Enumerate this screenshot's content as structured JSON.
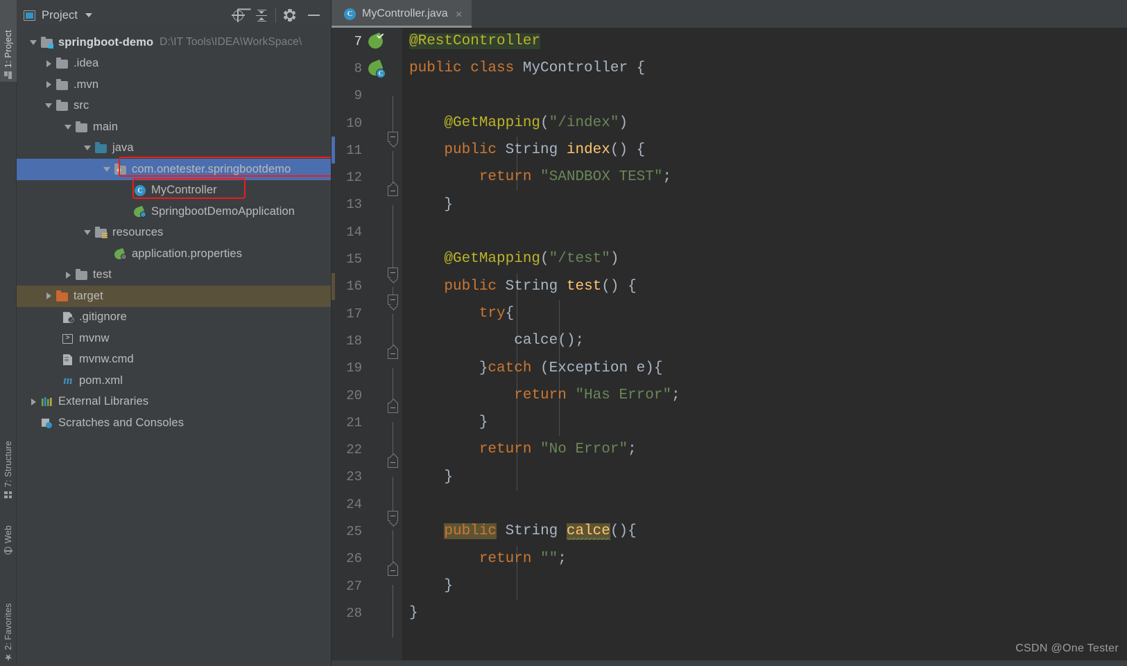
{
  "tool_strip": {
    "tabs": [
      {
        "label": "1: Project",
        "icon": "project-icon",
        "active": true
      },
      {
        "label": "7: Structure",
        "icon": "structure-icon",
        "active": false
      },
      {
        "label": "Web",
        "icon": "web-icon",
        "active": false
      },
      {
        "label": "2: Favorites",
        "icon": "favorites-icon",
        "active": false
      }
    ]
  },
  "project_panel": {
    "title": "Project",
    "toolbar": {
      "locate_icon": "crosshair-locate-icon",
      "collapse_icon": "collapse-all-icon",
      "settings_icon": "gear-icon",
      "minimize_icon": "minimize-icon"
    },
    "tree": [
      {
        "label": "springboot-demo",
        "path": "D:\\IT Tools\\IDEA\\WorkSpace\\",
        "depth": 0,
        "twist": "open",
        "icon": "module-folder-icon",
        "bold": true
      },
      {
        "label": ".idea",
        "path": "",
        "depth": 1,
        "twist": "closed",
        "icon": "folder-icon",
        "bold": false
      },
      {
        "label": ".mvn",
        "path": "",
        "depth": 1,
        "twist": "closed",
        "icon": "folder-icon",
        "bold": false
      },
      {
        "label": "src",
        "path": "",
        "depth": 1,
        "twist": "open",
        "icon": "folder-icon",
        "bold": false
      },
      {
        "label": "main",
        "path": "",
        "depth": 2,
        "twist": "open",
        "icon": "folder-icon",
        "bold": false
      },
      {
        "label": "java",
        "path": "",
        "depth": 3,
        "twist": "open",
        "icon": "source-root-folder-icon",
        "bold": false
      },
      {
        "label": "com.onetester.springbootdemo",
        "path": "",
        "depth": 4,
        "twist": "open",
        "icon": "package-icon",
        "bold": false,
        "selected": true,
        "annotated": true
      },
      {
        "label": "MyController",
        "path": "",
        "depth": 5,
        "twist": "none",
        "icon": "java-class-icon",
        "bold": false,
        "annotated": true
      },
      {
        "label": "SpringbootDemoApplication",
        "path": "",
        "depth": 5,
        "twist": "none",
        "icon": "spring-class-icon",
        "bold": false
      },
      {
        "label": "resources",
        "path": "",
        "depth": 3,
        "twist": "open",
        "icon": "resources-folder-icon",
        "bold": false
      },
      {
        "label": "application.properties",
        "path": "",
        "depth": 4,
        "twist": "none",
        "icon": "spring-properties-icon",
        "bold": false
      },
      {
        "label": "test",
        "path": "",
        "depth": 2,
        "twist": "closed",
        "icon": "folder-icon",
        "bold": false
      },
      {
        "label": "target",
        "path": "",
        "depth": 1,
        "twist": "closed",
        "icon": "excluded-folder-icon",
        "bold": false,
        "highlighted": true
      },
      {
        "label": ".gitignore",
        "path": "",
        "depth": 1,
        "twist": "none",
        "icon": "gitignore-file-icon",
        "bold": false
      },
      {
        "label": "mvnw",
        "path": "",
        "depth": 1,
        "twist": "none",
        "icon": "shell-script-icon",
        "bold": false
      },
      {
        "label": "mvnw.cmd",
        "path": "",
        "depth": 1,
        "twist": "none",
        "icon": "cmd-file-icon",
        "bold": false
      },
      {
        "label": "pom.xml",
        "path": "",
        "depth": 1,
        "twist": "none",
        "icon": "maven-pom-icon",
        "bold": false
      },
      {
        "label": "External Libraries",
        "path": "",
        "depth": 0,
        "twist": "closed",
        "icon": "external-libraries-icon",
        "bold": false
      },
      {
        "label": "Scratches and Consoles",
        "path": "",
        "depth": 0,
        "twist": "none",
        "icon": "scratches-icon",
        "bold": false
      }
    ]
  },
  "editor": {
    "tab": {
      "label": "MyController.java",
      "icon_letter": "C",
      "close_label": "×"
    },
    "first_line_number": 7,
    "lines": [
      {
        "num": 7,
        "gutter_icon": "spring-bean-check-icon",
        "fold": "none",
        "current": true,
        "tokens": [
          {
            "t": "@RestController",
            "c": "anno",
            "hl": "green"
          }
        ]
      },
      {
        "num": 8,
        "gutter_icon": "spring-bean-class-icon",
        "fold": "none",
        "current": false,
        "tokens": [
          {
            "t": "public ",
            "c": "kw"
          },
          {
            "t": "class ",
            "c": "kw"
          },
          {
            "t": "MyController ",
            "c": "typ"
          },
          {
            "t": "{",
            "c": "pun"
          }
        ]
      },
      {
        "num": 9,
        "gutter_icon": "none",
        "fold": "none",
        "current": false,
        "tokens": []
      },
      {
        "num": 10,
        "gutter_icon": "none",
        "fold": "none",
        "current": false,
        "tokens": [
          {
            "t": "    @GetMapping",
            "c": "anno"
          },
          {
            "t": "(",
            "c": "pun"
          },
          {
            "t": "\"/index\"",
            "c": "str"
          },
          {
            "t": ")",
            "c": "pun"
          }
        ]
      },
      {
        "num": 11,
        "gutter_icon": "none",
        "fold": "start",
        "current": false,
        "marker": "blue",
        "tokens": [
          {
            "t": "    ",
            "c": "plain"
          },
          {
            "t": "public ",
            "c": "kw"
          },
          {
            "t": "String ",
            "c": "typ"
          },
          {
            "t": "index",
            "c": "mth"
          },
          {
            "t": "() {",
            "c": "pun"
          }
        ]
      },
      {
        "num": 12,
        "gutter_icon": "none",
        "fold": "mid",
        "current": false,
        "tokens": [
          {
            "t": "        ",
            "c": "plain"
          },
          {
            "t": "return ",
            "c": "kw"
          },
          {
            "t": "\"SANDBOX TEST\"",
            "c": "str"
          },
          {
            "t": ";",
            "c": "pun"
          }
        ]
      },
      {
        "num": 13,
        "gutter_icon": "none",
        "fold": "end",
        "current": false,
        "tokens": [
          {
            "t": "    }",
            "c": "pun"
          }
        ]
      },
      {
        "num": 14,
        "gutter_icon": "none",
        "fold": "none",
        "current": false,
        "tokens": []
      },
      {
        "num": 15,
        "gutter_icon": "none",
        "fold": "none",
        "current": false,
        "tokens": [
          {
            "t": "    @GetMapping",
            "c": "anno"
          },
          {
            "t": "(",
            "c": "pun"
          },
          {
            "t": "\"/test\"",
            "c": "str"
          },
          {
            "t": ")",
            "c": "pun"
          }
        ]
      },
      {
        "num": 16,
        "gutter_icon": "none",
        "fold": "start",
        "current": false,
        "marker": "olive",
        "tokens": [
          {
            "t": "    ",
            "c": "plain"
          },
          {
            "t": "public ",
            "c": "kw"
          },
          {
            "t": "String ",
            "c": "typ"
          },
          {
            "t": "test",
            "c": "mth"
          },
          {
            "t": "() {",
            "c": "pun"
          }
        ]
      },
      {
        "num": 17,
        "gutter_icon": "none",
        "fold": "start",
        "current": false,
        "tokens": [
          {
            "t": "        ",
            "c": "plain"
          },
          {
            "t": "try",
            "c": "kw"
          },
          {
            "t": "{",
            "c": "pun"
          }
        ]
      },
      {
        "num": 18,
        "gutter_icon": "none",
        "fold": "mid",
        "current": false,
        "tokens": [
          {
            "t": "            calce",
            "c": "typ"
          },
          {
            "t": "();",
            "c": "pun"
          }
        ]
      },
      {
        "num": 19,
        "gutter_icon": "none",
        "fold": "end",
        "current": false,
        "tokens": [
          {
            "t": "        }",
            "c": "pun"
          },
          {
            "t": "catch ",
            "c": "kw"
          },
          {
            "t": "(Exception e){",
            "c": "typ"
          }
        ]
      },
      {
        "num": 20,
        "gutter_icon": "none",
        "fold": "mid",
        "current": false,
        "tokens": [
          {
            "t": "            ",
            "c": "plain"
          },
          {
            "t": "return ",
            "c": "kw"
          },
          {
            "t": "\"Has Error\"",
            "c": "str"
          },
          {
            "t": ";",
            "c": "pun"
          }
        ]
      },
      {
        "num": 21,
        "gutter_icon": "none",
        "fold": "end",
        "current": false,
        "tokens": [
          {
            "t": "        }",
            "c": "pun"
          }
        ]
      },
      {
        "num": 22,
        "gutter_icon": "none",
        "fold": "mid",
        "current": false,
        "tokens": [
          {
            "t": "        ",
            "c": "plain"
          },
          {
            "t": "return ",
            "c": "kw"
          },
          {
            "t": "\"No Error\"",
            "c": "str"
          },
          {
            "t": ";",
            "c": "pun"
          }
        ]
      },
      {
        "num": 23,
        "gutter_icon": "none",
        "fold": "end",
        "current": false,
        "tokens": [
          {
            "t": "    }",
            "c": "pun"
          }
        ]
      },
      {
        "num": 24,
        "gutter_icon": "none",
        "fold": "none",
        "current": false,
        "tokens": []
      },
      {
        "num": 25,
        "gutter_icon": "none",
        "fold": "start",
        "current": false,
        "tokens": [
          {
            "t": "    ",
            "c": "plain"
          },
          {
            "t": "public",
            "c": "kw",
            "hl": "olive"
          },
          {
            "t": " ",
            "c": "plain"
          },
          {
            "t": "String ",
            "c": "typ"
          },
          {
            "t": "calce",
            "c": "mth",
            "hl": "olive",
            "wavy": true
          },
          {
            "t": "(){",
            "c": "pun"
          }
        ]
      },
      {
        "num": 26,
        "gutter_icon": "none",
        "fold": "mid",
        "current": false,
        "tokens": [
          {
            "t": "        ",
            "c": "plain"
          },
          {
            "t": "return ",
            "c": "kw"
          },
          {
            "t": "\"\"",
            "c": "str"
          },
          {
            "t": ";",
            "c": "pun"
          }
        ]
      },
      {
        "num": 27,
        "gutter_icon": "none",
        "fold": "end",
        "current": false,
        "tokens": [
          {
            "t": "    }",
            "c": "pun"
          }
        ]
      },
      {
        "num": 28,
        "gutter_icon": "none",
        "fold": "none",
        "current": false,
        "tokens": [
          {
            "t": "}",
            "c": "pun"
          }
        ]
      }
    ]
  },
  "watermark": "CSDN @One Tester",
  "colors": {
    "panel_bg": "#3c3f41",
    "editor_bg": "#2b2b2b",
    "gutter_bg": "#313335",
    "selection_blue": "#4b6eaf",
    "target_highlight": "#5a513b",
    "annotation_red": "#ee1c1c",
    "keyword_orange": "#cc7832",
    "annotation_yellow": "#bbb529",
    "string_green": "#6a8759",
    "type_grey": "#a9b7c6",
    "method_gold": "#ffc66d",
    "green_highlight": "#32402e",
    "olive_highlight": "#5d5434"
  }
}
